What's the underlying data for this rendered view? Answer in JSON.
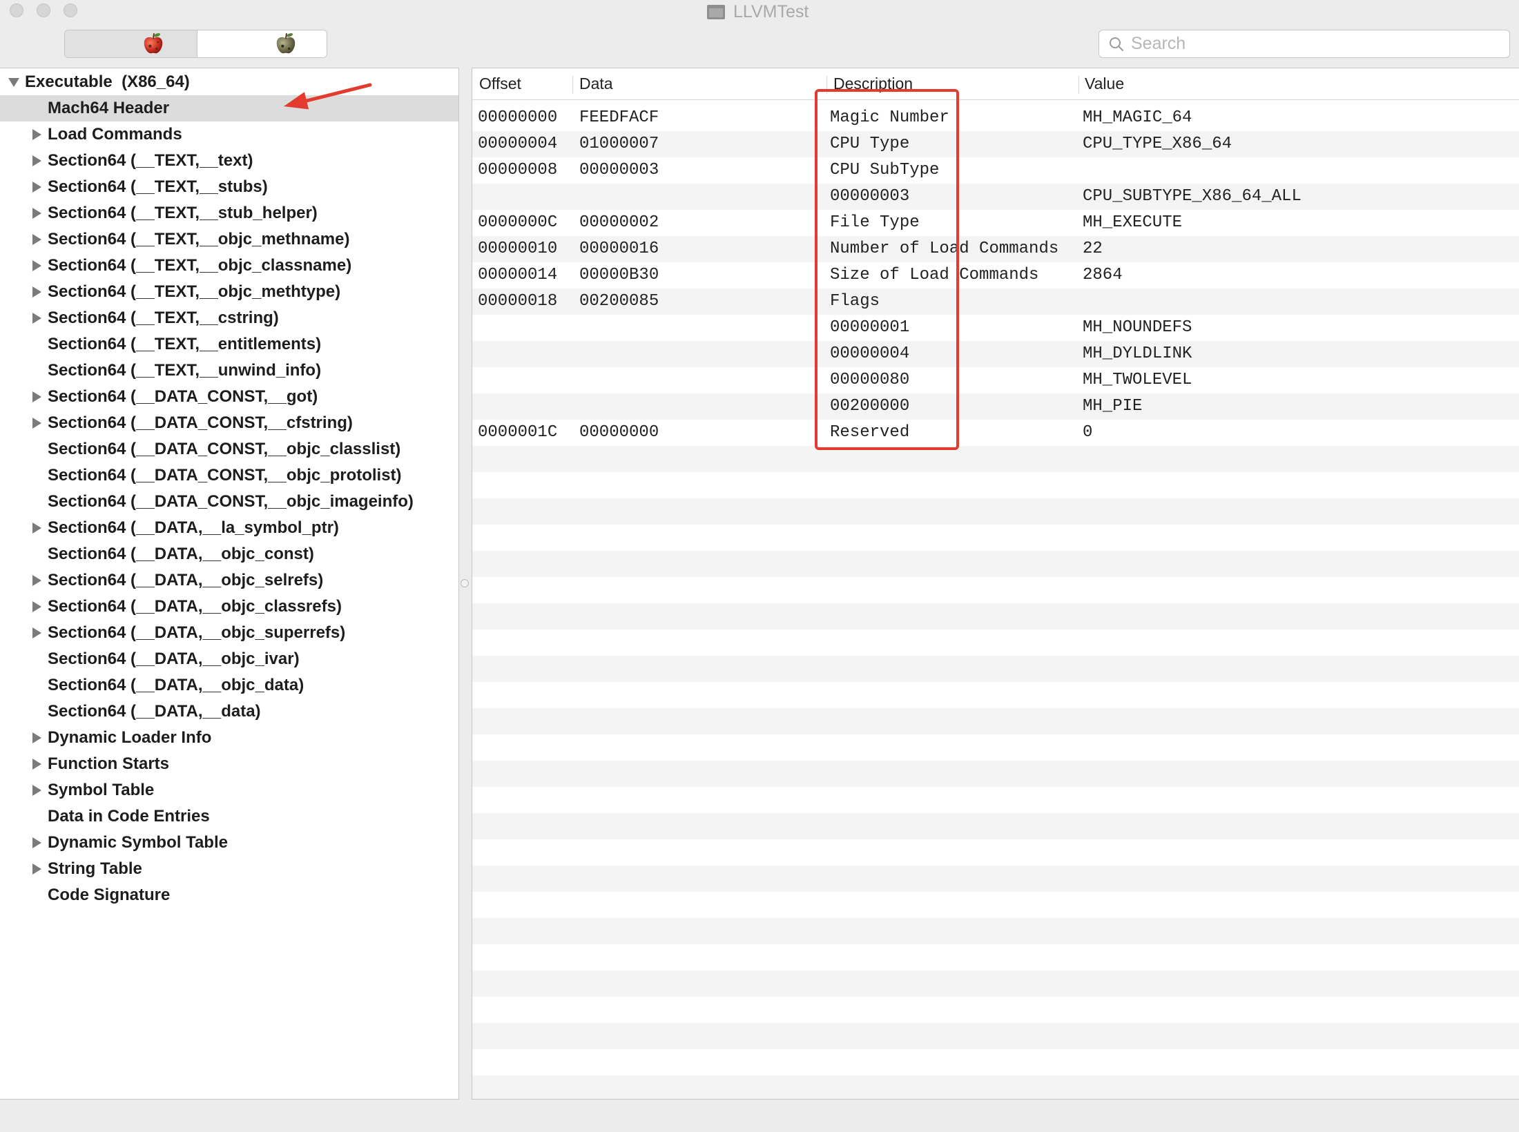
{
  "window": {
    "title": "LLVMTest",
    "title_icon": "document-icon"
  },
  "toolbar": {
    "segments": [
      {
        "icon": "red-apple-icon",
        "selected": true
      },
      {
        "icon": "gray-apple-icon",
        "selected": false
      }
    ],
    "search": {
      "placeholder": "Search",
      "value": ""
    }
  },
  "tree": {
    "items": [
      {
        "label": "Executable  (X86_64)",
        "level": 0,
        "toggle_icon": "triangle-down-icon"
      },
      {
        "label": "Mach64 Header",
        "level": 1,
        "selected": true
      },
      {
        "label": "Load Commands",
        "level": 1,
        "toggle_icon": "triangle-right-icon"
      },
      {
        "label": "Section64 (__TEXT,__text)",
        "level": 1,
        "toggle_icon": "triangle-right-icon"
      },
      {
        "label": "Section64 (__TEXT,__stubs)",
        "level": 1,
        "toggle_icon": "triangle-right-icon"
      },
      {
        "label": "Section64 (__TEXT,__stub_helper)",
        "level": 1,
        "toggle_icon": "triangle-right-icon"
      },
      {
        "label": "Section64 (__TEXT,__objc_methname)",
        "level": 1,
        "toggle_icon": "triangle-right-icon"
      },
      {
        "label": "Section64 (__TEXT,__objc_classname)",
        "level": 1,
        "toggle_icon": "triangle-right-icon"
      },
      {
        "label": "Section64 (__TEXT,__objc_methtype)",
        "level": 1,
        "toggle_icon": "triangle-right-icon"
      },
      {
        "label": "Section64 (__TEXT,__cstring)",
        "level": 1,
        "toggle_icon": "triangle-right-icon"
      },
      {
        "label": "Section64 (__TEXT,__entitlements)",
        "level": 1
      },
      {
        "label": "Section64 (__TEXT,__unwind_info)",
        "level": 1
      },
      {
        "label": "Section64 (__DATA_CONST,__got)",
        "level": 1,
        "toggle_icon": "triangle-right-icon"
      },
      {
        "label": "Section64 (__DATA_CONST,__cfstring)",
        "level": 1,
        "toggle_icon": "triangle-right-icon"
      },
      {
        "label": "Section64 (__DATA_CONST,__objc_classlist)",
        "level": 1
      },
      {
        "label": "Section64 (__DATA_CONST,__objc_protolist)",
        "level": 1
      },
      {
        "label": "Section64 (__DATA_CONST,__objc_imageinfo)",
        "level": 1
      },
      {
        "label": "Section64 (__DATA,__la_symbol_ptr)",
        "level": 1,
        "toggle_icon": "triangle-right-icon"
      },
      {
        "label": "Section64 (__DATA,__objc_const)",
        "level": 1
      },
      {
        "label": "Section64 (__DATA,__objc_selrefs)",
        "level": 1,
        "toggle_icon": "triangle-right-icon"
      },
      {
        "label": "Section64 (__DATA,__objc_classrefs)",
        "level": 1,
        "toggle_icon": "triangle-right-icon"
      },
      {
        "label": "Section64 (__DATA,__objc_superrefs)",
        "level": 1,
        "toggle_icon": "triangle-right-icon"
      },
      {
        "label": "Section64 (__DATA,__objc_ivar)",
        "level": 1
      },
      {
        "label": "Section64 (__DATA,__objc_data)",
        "level": 1
      },
      {
        "label": "Section64 (__DATA,__data)",
        "level": 1
      },
      {
        "label": "Dynamic Loader Info",
        "level": 1,
        "toggle_icon": "triangle-right-icon"
      },
      {
        "label": "Function Starts",
        "level": 1,
        "toggle_icon": "triangle-right-icon"
      },
      {
        "label": "Symbol Table",
        "level": 1,
        "toggle_icon": "triangle-right-icon"
      },
      {
        "label": "Data in Code Entries",
        "level": 1
      },
      {
        "label": "Dynamic Symbol Table",
        "level": 1,
        "toggle_icon": "triangle-right-icon"
      },
      {
        "label": "String Table",
        "level": 1,
        "toggle_icon": "triangle-right-icon"
      },
      {
        "label": "Code Signature",
        "level": 1
      }
    ]
  },
  "table": {
    "columns": {
      "offset": "Offset",
      "data": "Data",
      "description": "Description",
      "value": "Value"
    },
    "rows": [
      {
        "offset": "00000000",
        "data": "FEEDFACF",
        "description": "Magic Number",
        "value": "MH_MAGIC_64"
      },
      {
        "offset": "00000004",
        "data": "01000007",
        "description": "CPU Type",
        "value": "CPU_TYPE_X86_64"
      },
      {
        "offset": "00000008",
        "data": "00000003",
        "description": "CPU SubType",
        "value": ""
      },
      {
        "offset": "",
        "data": "",
        "description": "00000003",
        "value": "CPU_SUBTYPE_X86_64_ALL"
      },
      {
        "offset": "0000000C",
        "data": "00000002",
        "description": "File Type",
        "value": "MH_EXECUTE"
      },
      {
        "offset": "00000010",
        "data": "00000016",
        "description": "Number of Load Commands",
        "value": "22"
      },
      {
        "offset": "00000014",
        "data": "00000B30",
        "description": "Size of Load Commands",
        "value": "2864"
      },
      {
        "offset": "00000018",
        "data": "00200085",
        "description": "Flags",
        "value": ""
      },
      {
        "offset": "",
        "data": "",
        "description": "00000001",
        "value": "MH_NOUNDEFS"
      },
      {
        "offset": "",
        "data": "",
        "description": "00000004",
        "value": "MH_DYLDLINK"
      },
      {
        "offset": "",
        "data": "",
        "description": "00000080",
        "value": "MH_TWOLEVEL"
      },
      {
        "offset": "",
        "data": "",
        "description": "00200000",
        "value": "MH_PIE"
      },
      {
        "offset": "0000001C",
        "data": "00000000",
        "description": "Reserved",
        "value": "0"
      }
    ]
  },
  "colors": {
    "annotation": "#e33b2e",
    "selection": "#dcdcdc",
    "stripe": "#f4f4f5"
  }
}
